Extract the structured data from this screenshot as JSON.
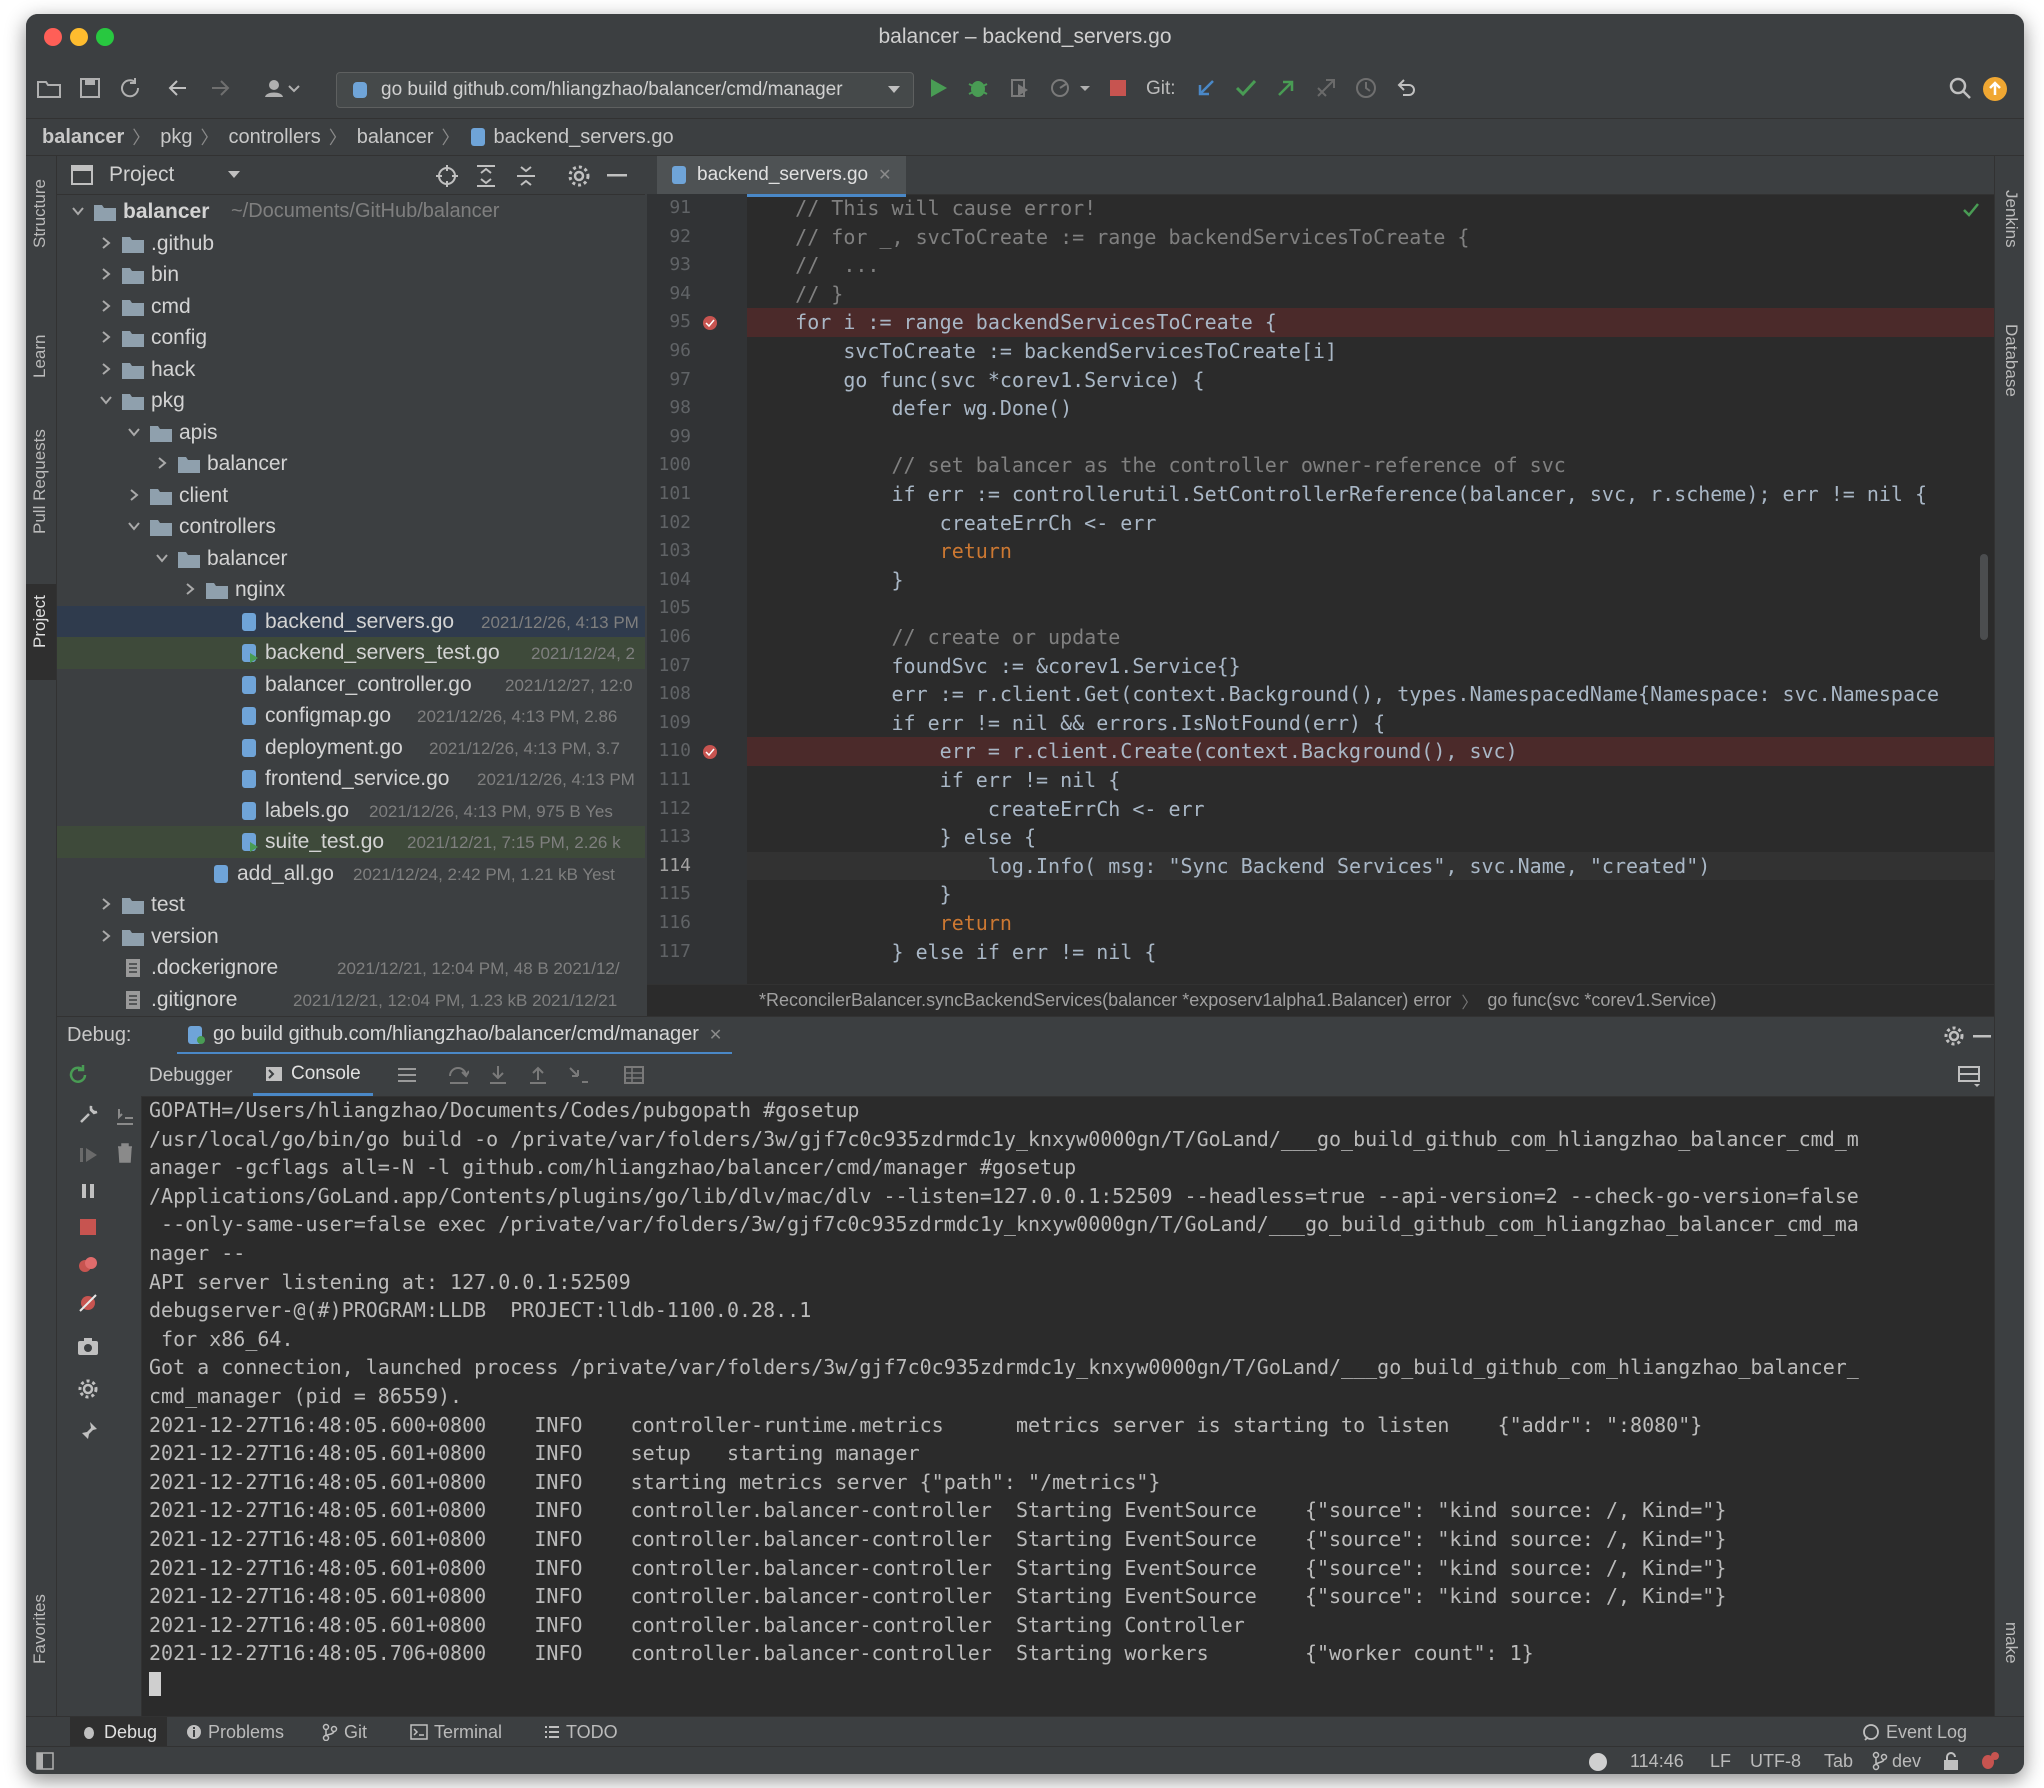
{
  "window": {
    "title": "balancer – backend_servers.go"
  },
  "toolbar": {
    "run_config": "go build github.com/hliangzhao/balancer/cmd/manager",
    "git_label": "Git:"
  },
  "breadcrumb": [
    "balancer",
    "pkg",
    "controllers",
    "balancer",
    "backend_servers.go"
  ],
  "left_strip": [
    "Structure",
    "Learn",
    "Pull Requests",
    "Project",
    "Favorites"
  ],
  "right_strip": [
    "Jenkins",
    "Database",
    "make"
  ],
  "project": {
    "header": "Project",
    "tree": [
      {
        "name": "balancer",
        "meta": "~/Documents/GitHub/balancer",
        "kind": "root"
      },
      {
        "name": ".github",
        "kind": "folder"
      },
      {
        "name": "bin",
        "kind": "folder"
      },
      {
        "name": "cmd",
        "kind": "folder"
      },
      {
        "name": "config",
        "kind": "folder"
      },
      {
        "name": "hack",
        "kind": "folder"
      },
      {
        "name": "pkg",
        "kind": "folder-open"
      },
      {
        "name": "apis",
        "kind": "folder-open"
      },
      {
        "name": "balancer",
        "kind": "folder"
      },
      {
        "name": "client",
        "kind": "folder"
      },
      {
        "name": "controllers",
        "kind": "folder-open"
      },
      {
        "name": "balancer",
        "kind": "folder-open"
      },
      {
        "name": "nginx",
        "kind": "folder"
      },
      {
        "name": "backend_servers.go",
        "meta": "2021/12/26, 4:13 PM",
        "kind": "gofile"
      },
      {
        "name": "backend_servers_test.go",
        "meta": "2021/12/24, 2",
        "kind": "gotest"
      },
      {
        "name": "balancer_controller.go",
        "meta": "2021/12/27, 12:0",
        "kind": "gofile"
      },
      {
        "name": "configmap.go",
        "meta": "2021/12/26, 4:13 PM, 2.86",
        "kind": "gofile"
      },
      {
        "name": "deployment.go",
        "meta": "2021/12/26, 4:13 PM, 3.7",
        "kind": "gofile"
      },
      {
        "name": "frontend_service.go",
        "meta": "2021/12/26, 4:13 PM",
        "kind": "gofile"
      },
      {
        "name": "labels.go",
        "meta": "2021/12/26, 4:13 PM, 975 B Yes",
        "kind": "gofile"
      },
      {
        "name": "suite_test.go",
        "meta": "2021/12/21, 7:15 PM, 2.26 k",
        "kind": "gotest"
      },
      {
        "name": "add_all.go",
        "meta": "2021/12/24, 2:42 PM, 1.21 kB Yest",
        "kind": "gofile"
      },
      {
        "name": "test",
        "kind": "folder"
      },
      {
        "name": "version",
        "kind": "folder"
      },
      {
        "name": ".dockerignore",
        "meta": "2021/12/21, 12:04 PM, 48 B 2021/12/",
        "kind": "file"
      },
      {
        "name": ".gitignore",
        "meta": "2021/12/21, 12:04 PM, 1.23 kB 2021/12/21",
        "kind": "file"
      }
    ]
  },
  "editor": {
    "tab": "backend_servers.go",
    "lines": [
      {
        "n": "91",
        "t": "// This will cause error!"
      },
      {
        "n": "92",
        "t": "// for _, svcToCreate := range backendServicesToCreate {"
      },
      {
        "n": "93",
        "t": "//  ..."
      },
      {
        "n": "94",
        "t": "// }"
      },
      {
        "n": "95",
        "t": "for i := range backendServicesToCreate {"
      },
      {
        "n": "96",
        "t": "svcToCreate := backendServicesToCreate[i]"
      },
      {
        "n": "97",
        "t": "go func(svc *corev1.Service) {"
      },
      {
        "n": "98",
        "t": "defer wg.Done()"
      },
      {
        "n": "99",
        "t": ""
      },
      {
        "n": "100",
        "t": "// set balancer as the controller owner-reference of svc"
      },
      {
        "n": "101",
        "t": "if err := controllerutil.SetControllerReference(balancer, svc, r.scheme); err != nil {"
      },
      {
        "n": "102",
        "t": "createErrCh <- err"
      },
      {
        "n": "103",
        "t": "return"
      },
      {
        "n": "104",
        "t": "}"
      },
      {
        "n": "105",
        "t": ""
      },
      {
        "n": "106",
        "t": "// create or update"
      },
      {
        "n": "107",
        "t": "foundSvc := &corev1.Service{}"
      },
      {
        "n": "108",
        "t": "err := r.client.Get(context.Background(), types.NamespacedName{Namespace: svc.Namespace"
      },
      {
        "n": "109",
        "t": "if err != nil && errors.IsNotFound(err) {"
      },
      {
        "n": "110",
        "t": "err = r.client.Create(context.Background(), svc)"
      },
      {
        "n": "111",
        "t": "if err != nil {"
      },
      {
        "n": "112",
        "t": "createErrCh <- err"
      },
      {
        "n": "113",
        "t": "} else {"
      },
      {
        "n": "114",
        "t": "log.Info( msg: \"Sync Backend Services\", svc.Name, \"created\")"
      },
      {
        "n": "115",
        "t": "}"
      },
      {
        "n": "116",
        "t": "return"
      },
      {
        "n": "117",
        "t": "} else if err != nil {"
      }
    ],
    "crumbs": [
      "*ReconcilerBalancer.syncBackendServices(balancer *exposerv1alpha1.Balancer) error",
      "go func(svc *corev1.Service)"
    ]
  },
  "debug": {
    "label": "Debug:",
    "session_tab": "go build github.com/hliangzhao/balancer/cmd/manager",
    "tabs": [
      "Debugger",
      "Console"
    ],
    "console": [
      "GOPATH=/Users/hliangzhao/Documents/Codes/pubgopath #gosetup",
      "/usr/local/go/bin/go build -o /private/var/folders/3w/gjf7c0c935zdrmdc1y_knxyw0000gn/T/GoLand/___go_build_github_com_hliangzhao_balancer_cmd_m",
      "anager -gcflags all=-N -l github.com/hliangzhao/balancer/cmd/manager #gosetup",
      "/Applications/GoLand.app/Contents/plugins/go/lib/dlv/mac/dlv --listen=127.0.0.1:52509 --headless=true --api-version=2 --check-go-version=false",
      " --only-same-user=false exec /private/var/folders/3w/gjf7c0c935zdrmdc1y_knxyw0000gn/T/GoLand/___go_build_github_com_hliangzhao_balancer_cmd_ma",
      "nager --",
      "API server listening at: 127.0.0.1:52509",
      "debugserver-@(#)PROGRAM:LLDB  PROJECT:lldb-1100.0.28..1",
      " for x86_64.",
      "Got a connection, launched process /private/var/folders/3w/gjf7c0c935zdrmdc1y_knxyw0000gn/T/GoLand/___go_build_github_com_hliangzhao_balancer_",
      "cmd_manager (pid = 86559).",
      "2021-12-27T16:48:05.600+0800    INFO    controller-runtime.metrics      metrics server is starting to listen    {\"addr\": \":8080\"}",
      "2021-12-27T16:48:05.601+0800    INFO    setup   starting manager",
      "2021-12-27T16:48:05.601+0800    INFO    starting metrics server {\"path\": \"/metrics\"}",
      "2021-12-27T16:48:05.601+0800    INFO    controller.balancer-controller  Starting EventSource    {\"source\": \"kind source: /, Kind=\"}",
      "2021-12-27T16:48:05.601+0800    INFO    controller.balancer-controller  Starting EventSource    {\"source\": \"kind source: /, Kind=\"}",
      "2021-12-27T16:48:05.601+0800    INFO    controller.balancer-controller  Starting EventSource    {\"source\": \"kind source: /, Kind=\"}",
      "2021-12-27T16:48:05.601+0800    INFO    controller.balancer-controller  Starting EventSource    {\"source\": \"kind source: /, Kind=\"}",
      "2021-12-27T16:48:05.601+0800    INFO    controller.balancer-controller  Starting Controller",
      "2021-12-27T16:48:05.706+0800    INFO    controller.balancer-controller  Starting workers        {\"worker count\": 1}"
    ]
  },
  "toolwindows": [
    "Debug",
    "Problems",
    "Git",
    "Terminal",
    "TODO"
  ],
  "event_log": "Event Log",
  "status": {
    "position": "114:46",
    "line_sep": "LF",
    "encoding": "UTF-8",
    "indent": "Tab",
    "branch": "dev"
  },
  "colors": {
    "accent": "#4a88c7",
    "breakpoint": "#c75450",
    "run_green": "#499c54"
  }
}
